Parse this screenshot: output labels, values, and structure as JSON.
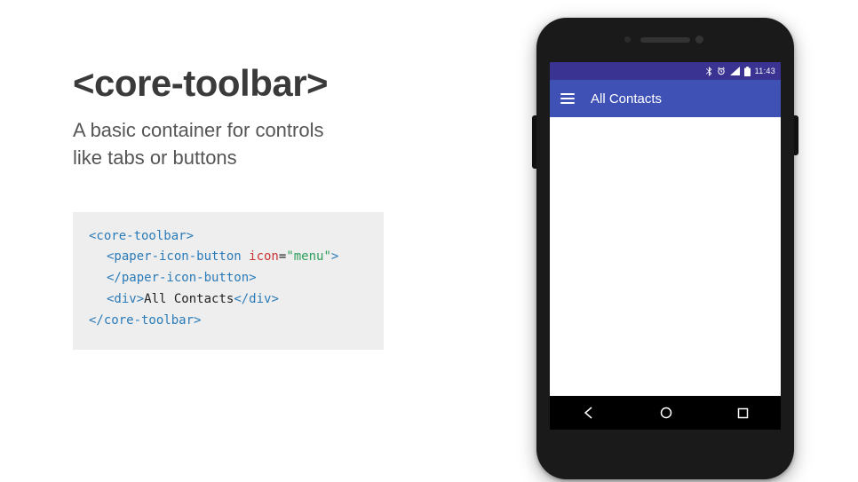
{
  "heading": "<core-toolbar>",
  "subtitle_line1": "A basic container for controls",
  "subtitle_line2": "like tabs or buttons",
  "code": {
    "l1_tag": "<core-toolbar>",
    "l2_tag_open": "<paper-icon-button",
    "l2_attr": " icon",
    "l2_eq": "=",
    "l2_val": "\"menu\"",
    "l2_close": ">",
    "l3_tag": "</paper-icon-button>",
    "l4_open": "<div>",
    "l4_text": "All Contacts",
    "l4_close": "</div>",
    "l5_tag": "</core-toolbar>"
  },
  "phone": {
    "status_time": "11:43",
    "appbar_title": "All Contacts"
  }
}
